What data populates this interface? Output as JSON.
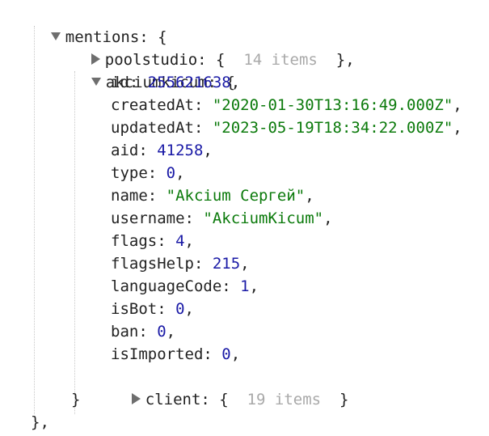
{
  "tree": {
    "root_key": "mentions",
    "pool": {
      "key": "poolstudio",
      "summary": "14 items"
    },
    "akcium": {
      "key": "akciumkicum",
      "fields": [
        {
          "key": "id",
          "value": "255621638",
          "type": "number"
        },
        {
          "key": "createdAt",
          "value": "\"2020-01-30T13:16:49.000Z\"",
          "type": "string"
        },
        {
          "key": "updatedAt",
          "value": "\"2023-05-19T18:34:22.000Z\"",
          "type": "string"
        },
        {
          "key": "aid",
          "value": "41258",
          "type": "number"
        },
        {
          "key": "type",
          "value": "0",
          "type": "number"
        },
        {
          "key": "name",
          "value": "\"Akcium Сергей\"",
          "type": "string"
        },
        {
          "key": "username",
          "value": "\"AkciumKicum\"",
          "type": "string"
        },
        {
          "key": "flags",
          "value": "4",
          "type": "number"
        },
        {
          "key": "flagsHelp",
          "value": "215",
          "type": "number"
        },
        {
          "key": "languageCode",
          "value": "1",
          "type": "number"
        },
        {
          "key": "isBot",
          "value": "0",
          "type": "number"
        },
        {
          "key": "ban",
          "value": "0",
          "type": "number"
        },
        {
          "key": "isImported",
          "value": "0",
          "type": "number"
        }
      ],
      "client": {
        "key": "client",
        "summary": "19 items"
      }
    }
  },
  "colors": {
    "number": "#1a1aa6",
    "string": "#0b7a0b",
    "summary": "#a9a9a9",
    "toggle": "#6e6e6e"
  }
}
